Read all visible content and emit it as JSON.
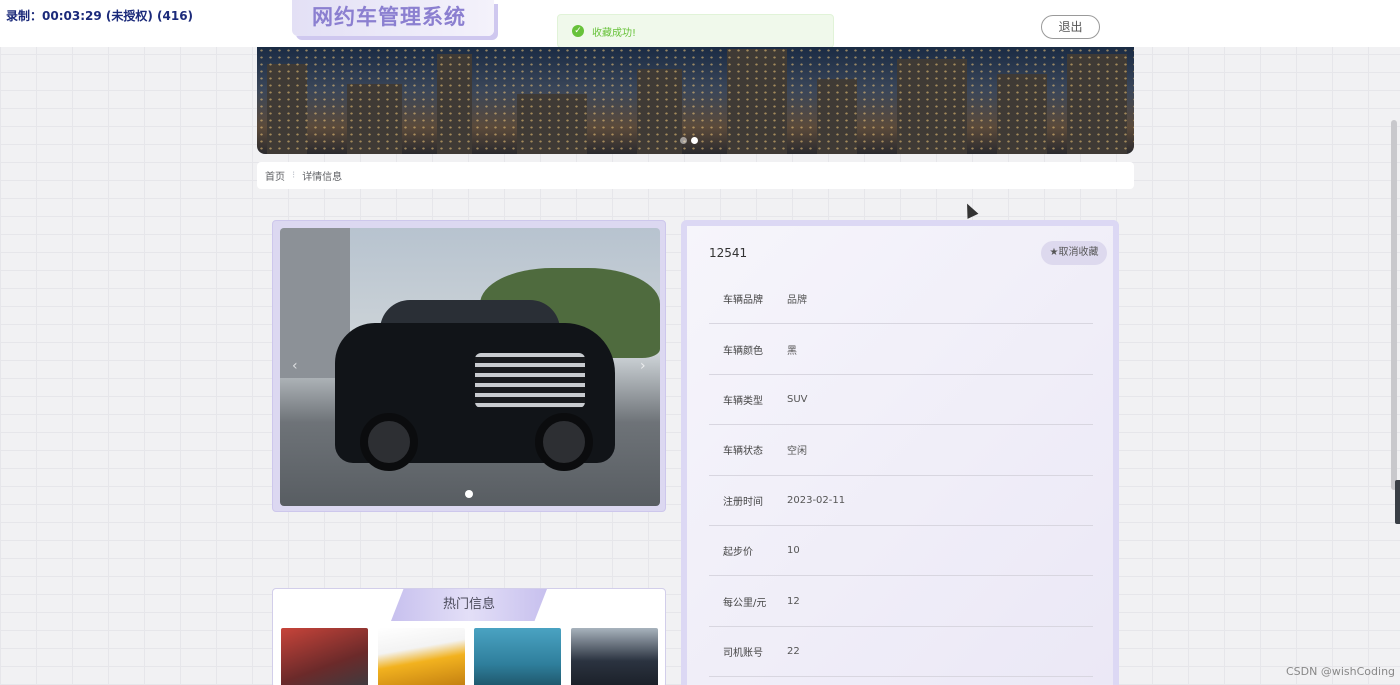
{
  "recording": "录制：00:03:29 (未授权) (416)",
  "header": {
    "logo_text": "网约车管理系统",
    "logout_label": "退出"
  },
  "toast": {
    "message": "收藏成功!",
    "icon": "check-circle-icon",
    "color": "#67c23a"
  },
  "breadcrumb": {
    "home": "首页",
    "current": "详情信息"
  },
  "detail": {
    "id": "12541",
    "favorite_label": "★取消收藏",
    "fields": [
      {
        "label": "车辆品牌",
        "value": "品牌"
      },
      {
        "label": "车辆颜色",
        "value": "黑"
      },
      {
        "label": "车辆类型",
        "value": "SUV"
      },
      {
        "label": "车辆状态",
        "value": "空闲"
      },
      {
        "label": "注册时间",
        "value": "2023-02-11"
      },
      {
        "label": "起步价",
        "value": "10"
      },
      {
        "label": "每公里/元",
        "value": "12"
      },
      {
        "label": "司机账号",
        "value": "22"
      }
    ]
  },
  "hot": {
    "title": "热门信息"
  },
  "watermark": "CSDN @wishCoding",
  "colors": {
    "accent": "#8b7fd0",
    "card_border": "#dcd8f4"
  }
}
